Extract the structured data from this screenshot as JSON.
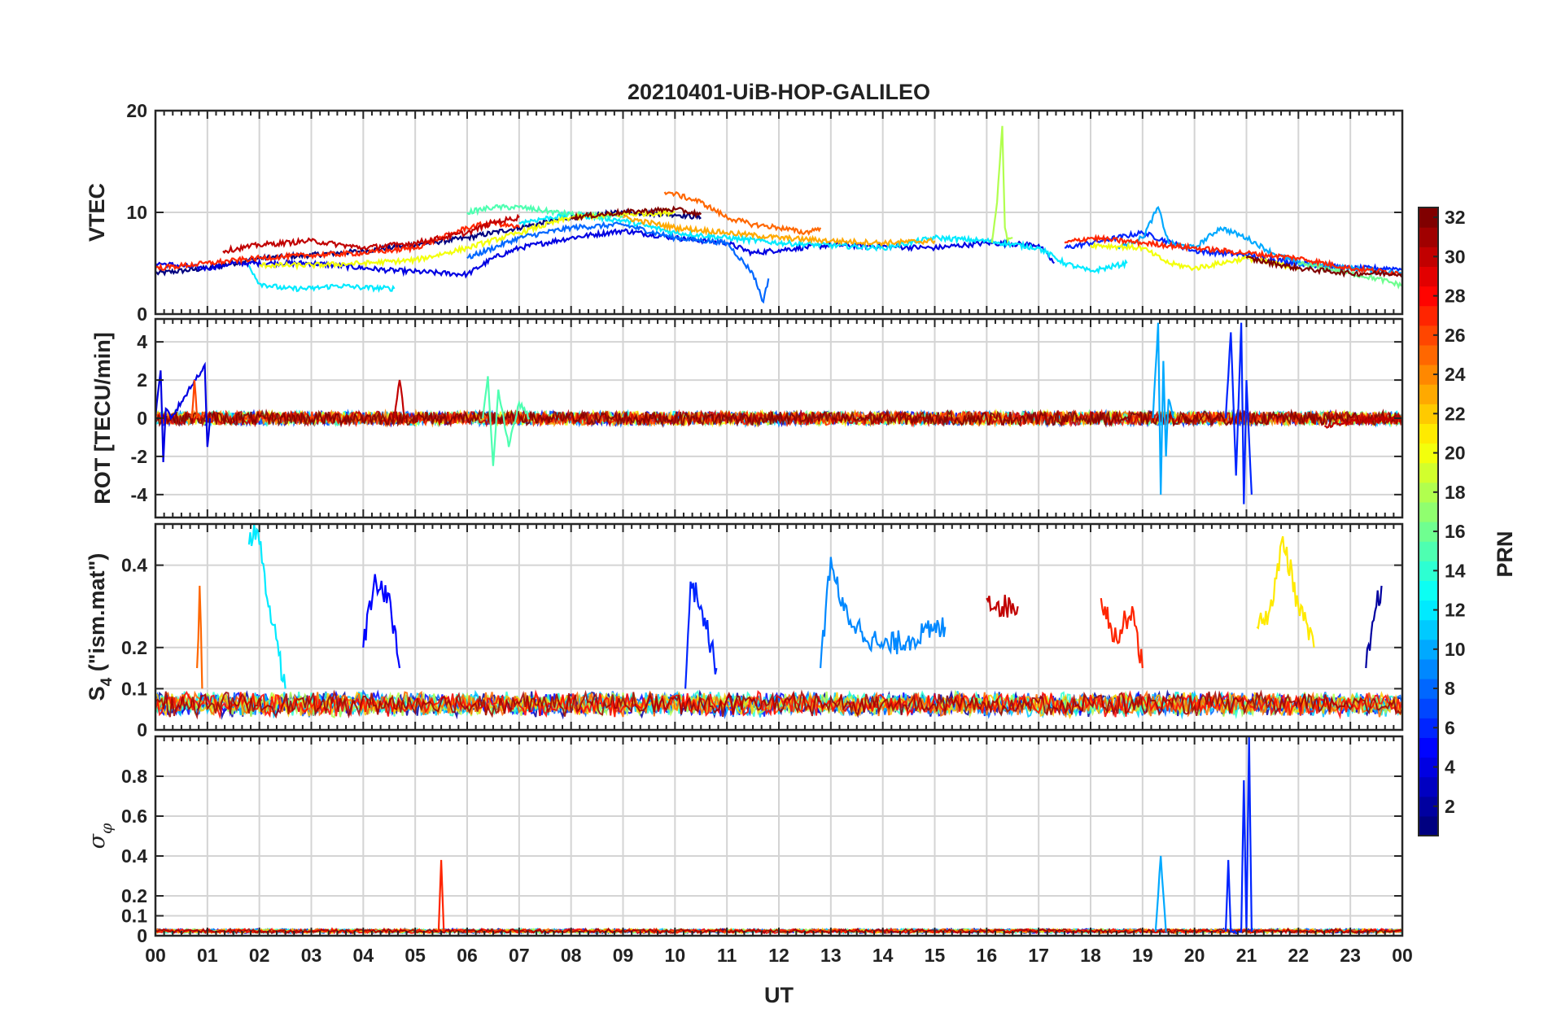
{
  "chart_data": {
    "type": "line",
    "title": "20210401-UiB-HOP-GALILEO",
    "xlabel": "UT",
    "x_ticks": [
      "00",
      "01",
      "02",
      "03",
      "04",
      "05",
      "06",
      "07",
      "08",
      "09",
      "10",
      "11",
      "12",
      "13",
      "14",
      "15",
      "16",
      "17",
      "18",
      "19",
      "20",
      "21",
      "22",
      "23",
      "00"
    ],
    "xlim_hours": [
      0,
      24
    ],
    "grid": true,
    "colorbar": {
      "label": "PRN",
      "ticks": [
        2,
        4,
        6,
        8,
        10,
        12,
        14,
        16,
        18,
        20,
        22,
        24,
        26,
        28,
        30,
        32
      ],
      "range": [
        1,
        32
      ],
      "colormap": "jet",
      "placement": "right"
    },
    "panels": [
      {
        "id": "vtec",
        "ylabel": "VTEC",
        "ylim": [
          0,
          20
        ],
        "yticks": [
          0,
          10,
          20
        ],
        "series": [
          {
            "prn": 1,
            "x": [
              0.0,
              1.0,
              2.0,
              3.0,
              4.0,
              5.0,
              6.0,
              7.0,
              8.0,
              9.0,
              10.0,
              10.5
            ],
            "values": [
              4,
              4.5,
              5.5,
              5.8,
              6.2,
              6.8,
              7.5,
              8.5,
              9.5,
              10,
              9.8,
              9.5
            ]
          },
          {
            "prn": 4,
            "x": [
              0.0,
              1.0,
              1.5,
              3.0,
              4.5,
              6.0,
              6.5,
              7.0,
              8.0,
              9.0,
              10.0,
              11.0,
              11.5,
              12.0,
              13.0,
              15.0,
              16.0,
              17.0,
              17.3
            ],
            "values": [
              5,
              4.5,
              5,
              5,
              4.3,
              3.9,
              5.5,
              6.5,
              7.5,
              8.2,
              7.5,
              7.0,
              6.0,
              6.3,
              6.8,
              6.5,
              7.0,
              6.8,
              5.0
            ]
          },
          {
            "prn": 6,
            "x": [
              17.5,
              18.5,
              19.0,
              20.0,
              21.0,
              22.0,
              23.0,
              24.0
            ],
            "values": [
              6.5,
              7.5,
              8.0,
              6.2,
              5.8,
              5.0,
              4.5,
              4.5
            ]
          },
          {
            "prn": 8,
            "x": [
              6.0,
              7.0,
              8.0,
              9.0,
              10.0,
              11.0,
              11.5,
              11.7,
              11.8
            ],
            "values": [
              5.5,
              7.5,
              8.5,
              8.8,
              7.5,
              7.0,
              4.0,
              1.2,
              3.5
            ]
          },
          {
            "prn": 10,
            "x": [
              18.5,
              19.0,
              19.3,
              19.5,
              20.0,
              20.5,
              21.0,
              21.5,
              22.0,
              23.0,
              24.0
            ],
            "values": [
              6.5,
              7.5,
              10.5,
              7.0,
              6.5,
              8.5,
              7.5,
              6.0,
              5.0,
              4.5,
              4.0
            ]
          },
          {
            "prn": 12,
            "x": [
              1.8,
              2.0,
              2.5,
              3.0,
              3.5,
              4.0,
              4.6
            ],
            "values": [
              4.8,
              3.0,
              2.5,
              2.5,
              2.8,
              2.6,
              2.5
            ]
          },
          {
            "prn": 12,
            "x": [
              7.0,
              8.0,
              9.0,
              10.0,
              12.0,
              14.0,
              15.0,
              16.0,
              17.0,
              17.5,
              18.0,
              18.7
            ],
            "values": [
              9.0,
              9.8,
              9.2,
              8.0,
              7.0,
              6.5,
              7.5,
              7.2,
              6.5,
              5.0,
              4.2,
              5.0
            ]
          },
          {
            "prn": 15,
            "x": [
              6.0,
              6.5,
              7.0,
              8.0,
              9.0
            ],
            "values": [
              10.0,
              10.5,
              10.5,
              9.8,
              9.5
            ]
          },
          {
            "prn": 16,
            "x": [
              22.0,
              22.5,
              23.0,
              23.5,
              24.0
            ],
            "values": [
              5.0,
              4.5,
              4.0,
              3.5,
              2.8
            ]
          },
          {
            "prn": 18,
            "x": [
              16.1,
              16.2,
              16.3,
              16.35,
              16.4,
              16.5
            ],
            "values": [
              7.0,
              11.0,
              18.5,
              8.5,
              7.2,
              7.5
            ]
          },
          {
            "prn": 20,
            "x": [
              2.0,
              3.0,
              4.0,
              5.0,
              6.0,
              7.0,
              8.0,
              9.0,
              10.0
            ],
            "values": [
              4.8,
              4.8,
              5.0,
              5.3,
              6.5,
              8.0,
              9.5,
              9.8,
              10.0
            ]
          },
          {
            "prn": 20,
            "x": [
              18.0,
              19.0,
              19.5,
              20.0,
              21.0,
              22.0
            ],
            "values": [
              6.8,
              6.5,
              5.0,
              4.5,
              5.5,
              4.5
            ]
          },
          {
            "prn": 23,
            "x": [
              9.0,
              10.0,
              11.0,
              12.0,
              13.0,
              14.0,
              15.0
            ],
            "values": [
              9.5,
              8.5,
              8.0,
              7.5,
              7.2,
              7.0,
              7.2
            ]
          },
          {
            "prn": 25,
            "x": [
              9.8,
              10.0,
              10.5,
              11.0,
              11.5,
              12.0,
              12.5,
              12.8
            ],
            "values": [
              12.0,
              11.8,
              11.0,
              9.5,
              8.8,
              8.5,
              8.0,
              8.5
            ]
          },
          {
            "prn": 27,
            "x": [
              0.0,
              1.0,
              2.0,
              3.0,
              4.0,
              5.0,
              5.5,
              6.0,
              6.5,
              7.0
            ],
            "values": [
              4.5,
              5.0,
              5.5,
              5.8,
              6.0,
              6.5,
              7.5,
              8.5,
              9.0,
              8.5
            ]
          },
          {
            "prn": 27,
            "x": [
              17.5,
              18.0,
              19.0,
              20.0,
              21.0,
              22.0,
              23.0,
              24.0
            ],
            "values": [
              7.0,
              7.5,
              7.0,
              6.5,
              6.0,
              5.5,
              4.5,
              4.0
            ]
          },
          {
            "prn": 30,
            "x": [
              1.3,
              2.0,
              3.0,
              4.0,
              5.0,
              6.0,
              6.5,
              7.0
            ],
            "values": [
              6.2,
              6.8,
              7.2,
              6.5,
              7.0,
              8.0,
              9.0,
              9.5
            ]
          },
          {
            "prn": 32,
            "x": [
              8.0,
              9.0,
              10.0,
              10.5
            ],
            "values": [
              9.5,
              10.0,
              10.3,
              9.8
            ]
          },
          {
            "prn": 32,
            "x": [
              21.0,
              22.0,
              23.0,
              24.0
            ],
            "values": [
              5.5,
              4.5,
              4.0,
              4.0
            ]
          }
        ]
      },
      {
        "id": "rot",
        "ylabel": "ROT [TECU/min]",
        "ylim": [
          -5.2,
          5.2
        ],
        "yticks": [
          -4,
          -2,
          0,
          2,
          4
        ],
        "series": [
          {
            "prn": 4,
            "x": [
              0.0,
              0.1,
              0.15,
              0.2,
              0.3,
              0.95,
              1.0,
              1.05
            ],
            "values": [
              0,
              2.5,
              -2.3,
              0.5,
              0,
              2.8,
              -1.5,
              0
            ]
          },
          {
            "prn": 6,
            "x": [
              20.6,
              20.7,
              20.8,
              20.9,
              20.95,
              21.0,
              21.1
            ],
            "values": [
              0,
              4.5,
              -3.0,
              5.0,
              -4.5,
              2.0,
              -4.0
            ]
          },
          {
            "prn": 10,
            "x": [
              19.2,
              19.3,
              19.35,
              19.4,
              19.45,
              19.5,
              19.6
            ],
            "values": [
              0,
              5.0,
              -4.0,
              3.0,
              -2.0,
              1.0,
              0
            ]
          },
          {
            "prn": 15,
            "x": [
              6.3,
              6.4,
              6.5,
              6.6,
              6.8,
              7.0,
              7.2
            ],
            "values": [
              0,
              2.2,
              -2.5,
              1.5,
              -1.5,
              0.8,
              0
            ]
          },
          {
            "prn": 26,
            "x": [
              0.7,
              0.75,
              0.8
            ],
            "values": [
              0,
              2.0,
              0
            ]
          },
          {
            "prn": 30,
            "x": [
              4.6,
              4.7,
              4.8
            ],
            "values": [
              0,
              2.0,
              0
            ]
          },
          {
            "prn": 30,
            "x": [
              22.5,
              23.0,
              24.0
            ],
            "values": [
              -0.4,
              -0.2,
              0
            ]
          }
        ]
      },
      {
        "id": "s4",
        "ylabel": "S4 (\"ism.mat\")",
        "ylabel_main": "S",
        "ylabel_sub": "4",
        "ylabel_rest": " (\"ism.mat\")",
        "ylim": [
          0,
          0.5
        ],
        "yticks": [
          0,
          0.1,
          0.2,
          0.4
        ],
        "series": [
          {
            "prn": 12,
            "x": [
              1.8,
              1.9,
              2.0,
              2.1,
              2.2,
              2.5
            ],
            "values": [
              0.45,
              0.5,
              0.45,
              0.38,
              0.3,
              0.1
            ]
          },
          {
            "prn": 25,
            "x": [
              0.8,
              0.85,
              0.9
            ],
            "values": [
              0.15,
              0.35,
              0.1
            ]
          },
          {
            "prn": 5,
            "x": [
              4.0,
              4.2,
              4.5,
              4.7
            ],
            "values": [
              0.2,
              0.35,
              0.33,
              0.15
            ]
          },
          {
            "prn": 6,
            "x": [
              10.2,
              10.3,
              10.5,
              10.8
            ],
            "values": [
              0.1,
              0.36,
              0.3,
              0.15
            ]
          },
          {
            "prn": 9,
            "x": [
              12.8,
              13.0,
              13.2,
              13.5,
              14.0,
              15.2
            ],
            "values": [
              0.15,
              0.42,
              0.3,
              0.25,
              0.2,
              0.25
            ]
          },
          {
            "prn": 30,
            "x": [
              16.0,
              16.3,
              16.6
            ],
            "values": [
              0.32,
              0.3,
              0.3
            ]
          },
          {
            "prn": 27,
            "x": [
              18.2,
              18.5,
              18.8,
              19.0
            ],
            "values": [
              0.32,
              0.22,
              0.3,
              0.15
            ]
          },
          {
            "prn": 21,
            "x": [
              21.2,
              21.5,
              21.7,
              22.0,
              22.3
            ],
            "values": [
              0.25,
              0.3,
              0.47,
              0.3,
              0.2
            ]
          },
          {
            "prn": 2,
            "x": [
              23.3,
              23.5,
              23.6
            ],
            "values": [
              0.15,
              0.3,
              0.35
            ]
          }
        ],
        "baseline_typical": 0.05
      },
      {
        "id": "sigma_phi",
        "ylabel": "σφ",
        "ylim": [
          0,
          1.0
        ],
        "yticks": [
          0,
          0.1,
          0.2,
          0.4,
          0.6,
          0.8
        ],
        "series": [
          {
            "prn": 27,
            "x": [
              5.45,
              5.5,
              5.55
            ],
            "values": [
              0.02,
              0.38,
              0.02
            ]
          },
          {
            "prn": 10,
            "x": [
              19.25,
              19.35,
              19.45
            ],
            "values": [
              0.02,
              0.4,
              0.02
            ]
          },
          {
            "prn": 6,
            "x": [
              20.6,
              20.65,
              20.7,
              20.9,
              20.95,
              21.0,
              21.05,
              21.1
            ],
            "values": [
              0.02,
              0.38,
              0.02,
              0.02,
              0.78,
              0.02,
              1.0,
              0.02
            ]
          }
        ],
        "baseline_typical": 0.02
      }
    ]
  }
}
